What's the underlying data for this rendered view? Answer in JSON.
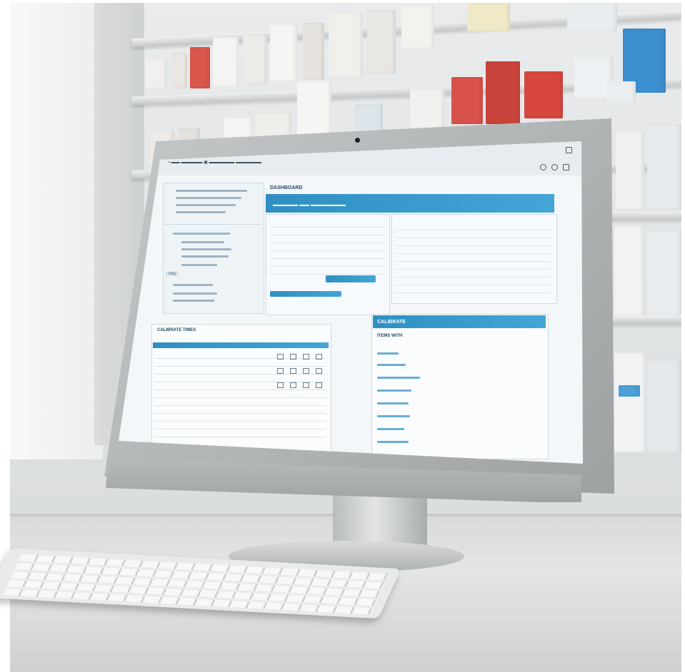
{
  "screen": {
    "dashboard_title": "DASHBOARD",
    "sidebar_help_tag": "FAQ",
    "bottom_section_title": "CALIBRATE TIMES",
    "right_panel_title": "CALIBRATE",
    "right_panel_subtitle": "ITEMS WITH"
  },
  "colors": {
    "accent": "#3a9bcf",
    "screen_bg": "#f4f7f9"
  },
  "icons": [
    "camera-icon",
    "window-icons"
  ]
}
